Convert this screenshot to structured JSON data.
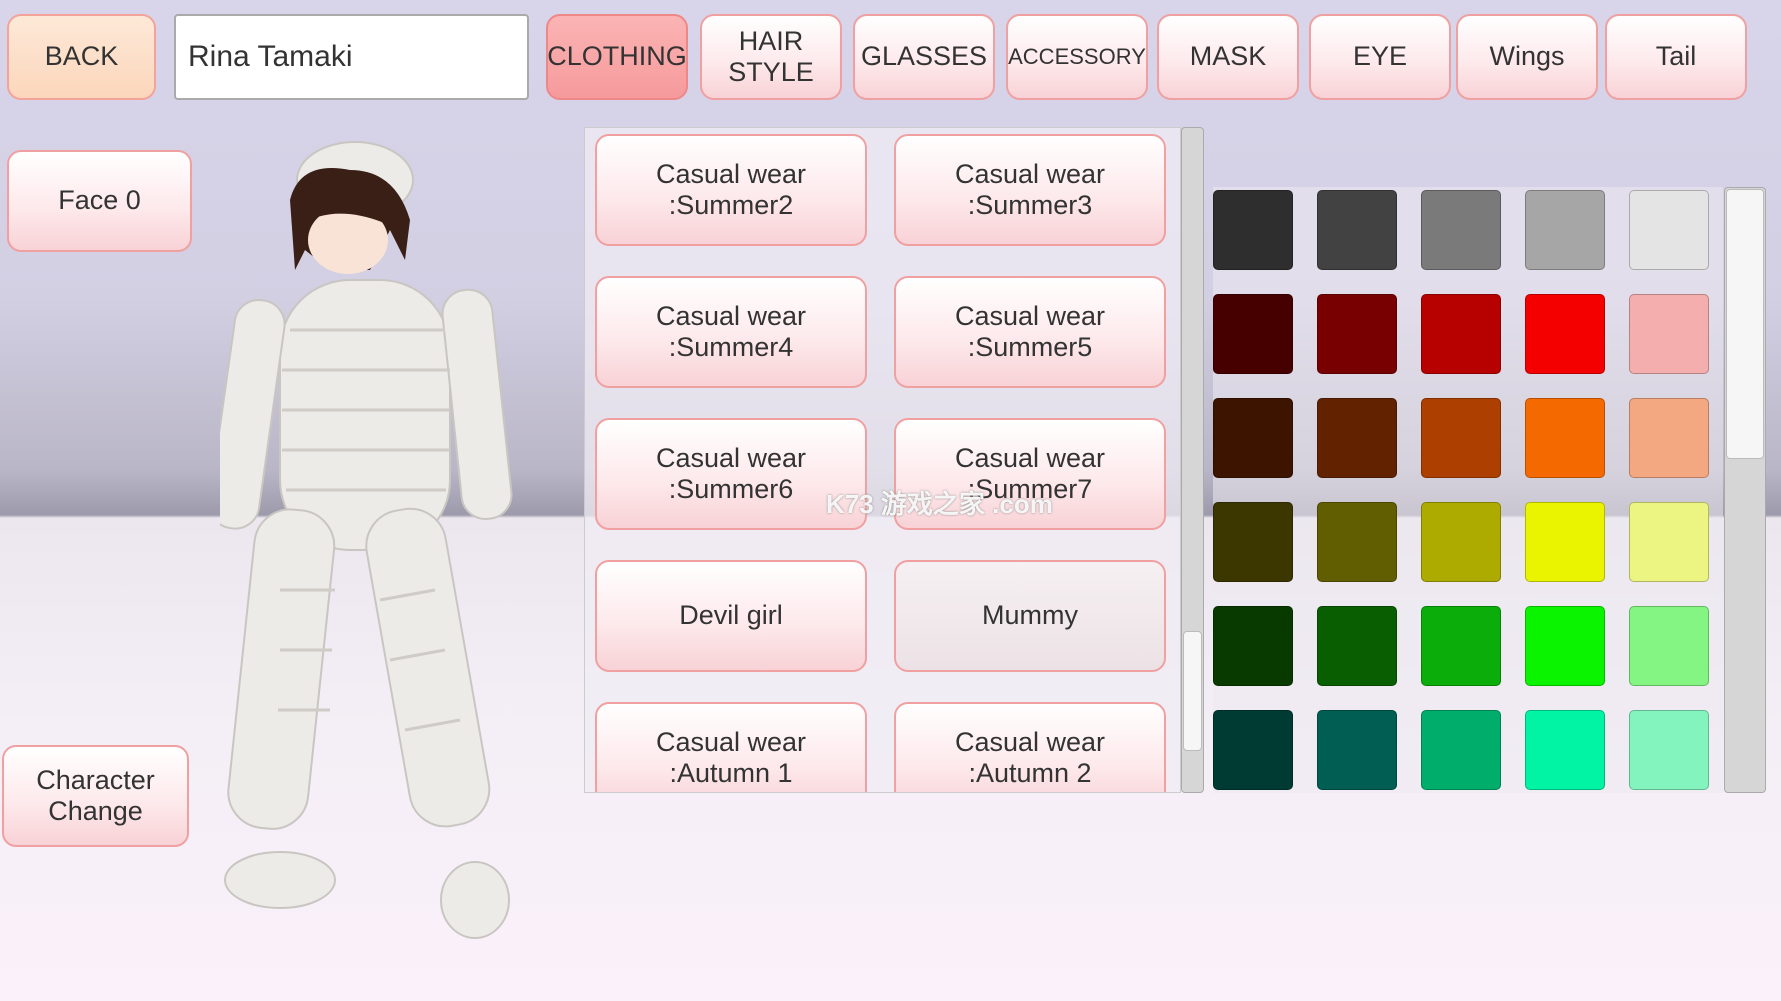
{
  "header": {
    "back_label": "BACK",
    "character_name": "Rina Tamaki",
    "tabs": [
      {
        "label": "CLOTHING",
        "active": true
      },
      {
        "label": "HAIR STYLE"
      },
      {
        "label": "GLASSES"
      },
      {
        "label": "ACCESSORY"
      },
      {
        "label": "MASK"
      },
      {
        "label": "EYE"
      },
      {
        "label": "Wings"
      },
      {
        "label": "Tail"
      }
    ]
  },
  "left": {
    "face_label": "Face 0",
    "character_change_label": "Character Change"
  },
  "clothing": {
    "items": [
      "Casual wear :Summer2",
      "Casual wear :Summer3",
      "Casual wear :Summer4",
      "Casual wear :Summer5",
      "Casual wear :Summer6",
      "Casual wear :Summer7",
      "Devil girl",
      "Mummy",
      "Casual wear :Autumn 1",
      "Casual wear :Autumn 2"
    ],
    "selected": "Mummy",
    "scroll_position": 0.85
  },
  "palette": {
    "colors": [
      [
        "#2e2e2e",
        "#424242",
        "#7a7a7a",
        "#a6a6a6",
        "#e4e4e4"
      ],
      [
        "#460000",
        "#780000",
        "#b70000",
        "#f40000",
        "#f4aeae"
      ],
      [
        "#3c1400",
        "#622200",
        "#ad3f00",
        "#f46a00",
        "#f4a882"
      ],
      [
        "#3c3600",
        "#605e00",
        "#adab00",
        "#ebf400",
        "#ecf482"
      ],
      [
        "#083a00",
        "#085e00",
        "#0aad0a",
        "#0af400",
        "#84f482"
      ],
      [
        "#003b33",
        "#005e52",
        "#00ad6a",
        "#00f4a4",
        "#84f4be"
      ]
    ],
    "scroll_position": 0.0
  },
  "watermark": "K73 游戏之家 .com"
}
